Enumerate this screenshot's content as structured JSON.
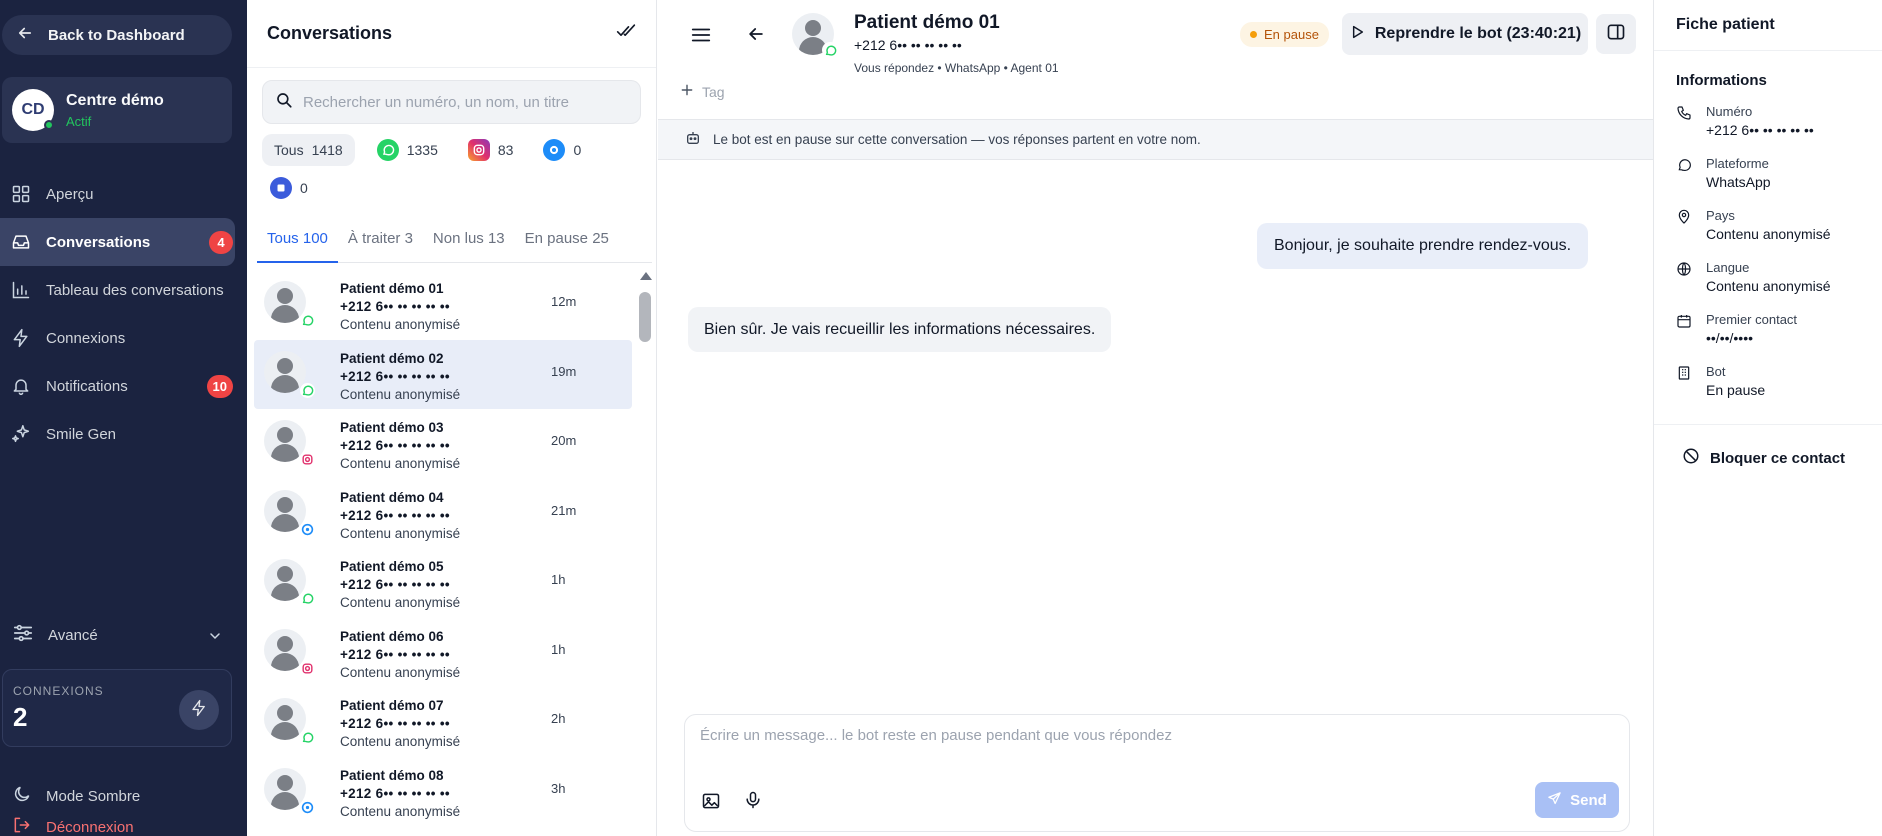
{
  "sidebar": {
    "back_label": "Back to Dashboard",
    "center": {
      "initials": "CD",
      "name": "Centre démo",
      "status": "Actif"
    },
    "nav": [
      {
        "label": "Aperçu",
        "icon": "grid-icon",
        "badge": null
      },
      {
        "label": "Conversations",
        "icon": "inbox-icon",
        "badge": "4"
      },
      {
        "label": "Tableau des conversations",
        "icon": "bar-chart-icon",
        "badge": null
      },
      {
        "label": "Connexions",
        "icon": "bolt-icon",
        "badge": null
      },
      {
        "label": "Notifications",
        "icon": "bell-icon",
        "badge": "10"
      },
      {
        "label": "Smile Gen",
        "icon": "sparkles-icon",
        "badge": null
      }
    ],
    "advanced_label": "Avancé",
    "connections": {
      "title": "CONNEXIONS",
      "count": "2"
    },
    "dark_mode_label": "Mode Sombre",
    "logout_label": "Déconnexion"
  },
  "conversations": {
    "title": "Conversations",
    "search_placeholder": "Rechercher un numéro, un nom, un titre",
    "filters": {
      "all_label": "Tous",
      "all_count": "1418",
      "whatsapp_count": "1335",
      "instagram_count": "83",
      "messenger_count": "0",
      "other_count": "0"
    },
    "tabs": [
      "Tous 100",
      "À traiter 3",
      "Non lus 13",
      "En pause 25"
    ],
    "rows": [
      {
        "name": "Patient démo 01",
        "phone": "+212 6•• •• •• •• ••",
        "subtitle": "Contenu anonymisé",
        "time": "12m",
        "platform": "whatsapp"
      },
      {
        "name": "Patient démo 02",
        "phone": "+212 6•• •• •• •• ••",
        "subtitle": "Contenu anonymisé",
        "time": "19m",
        "platform": "whatsapp"
      },
      {
        "name": "Patient démo 03",
        "phone": "+212 6•• •• •• •• ••",
        "subtitle": "Contenu anonymisé",
        "time": "20m",
        "platform": "instagram"
      },
      {
        "name": "Patient démo 04",
        "phone": "+212 6•• •• •• •• ••",
        "subtitle": "Contenu anonymisé",
        "time": "21m",
        "platform": "messenger"
      },
      {
        "name": "Patient démo 05",
        "phone": "+212 6•• •• •• •• ••",
        "subtitle": "Contenu anonymisé",
        "time": "1h",
        "platform": "whatsapp"
      },
      {
        "name": "Patient démo 06",
        "phone": "+212 6•• •• •• •• ••",
        "subtitle": "Contenu anonymisé",
        "time": "1h",
        "platform": "instagram"
      },
      {
        "name": "Patient démo 07",
        "phone": "+212 6•• •• •• •• ••",
        "subtitle": "Contenu anonymisé",
        "time": "2h",
        "platform": "whatsapp"
      },
      {
        "name": "Patient démo 08",
        "phone": "+212 6•• •• •• •• ••",
        "subtitle": "Contenu anonymisé",
        "time": "3h",
        "platform": "messenger"
      }
    ]
  },
  "chat": {
    "name": "Patient démo 01",
    "phone": "+212 6•• •• •• •• ••",
    "meta": "Vous répondez • WhatsApp • Agent 01",
    "status": "En pause",
    "resume_label": "Reprendre le bot (23:40:21)",
    "tag_label": "Tag",
    "banner": "Le bot est en pause sur cette conversation — vos réponses partent en votre nom.",
    "messages": [
      {
        "direction": "out",
        "text": "Bonjour, je souhaite prendre rendez-vous."
      },
      {
        "direction": "in",
        "text": "Bien sûr. Je vais recueillir les informations nécessaires."
      }
    ],
    "composer_placeholder": "Écrire un message... le bot reste en pause pendant que vous répondez",
    "send_label": "Send"
  },
  "patient": {
    "title": "Fiche patient",
    "section": "Informations",
    "fields": [
      {
        "label": "Numéro",
        "value": "+212 6•• •• •• •• ••",
        "icon": "phone-icon"
      },
      {
        "label": "Plateforme",
        "value": "WhatsApp",
        "icon": "chat-bubble-icon"
      },
      {
        "label": "Pays",
        "value": "Contenu anonymisé",
        "icon": "map-pin-icon"
      },
      {
        "label": "Langue",
        "value": "Contenu anonymisé",
        "icon": "globe-icon"
      },
      {
        "label": "Premier contact",
        "value": "••/••/••••",
        "icon": "calendar-icon"
      },
      {
        "label": "Bot",
        "value": "En pause",
        "icon": "building-icon"
      }
    ],
    "block_label": "Bloquer ce contact"
  },
  "colors": {
    "sidebar_bg": "#1b2340",
    "accent": "#2563eb",
    "badge": "#ef4444",
    "whatsapp": "#25d366",
    "instagram": "#e1306c",
    "messenger": "#1d8cf8"
  }
}
